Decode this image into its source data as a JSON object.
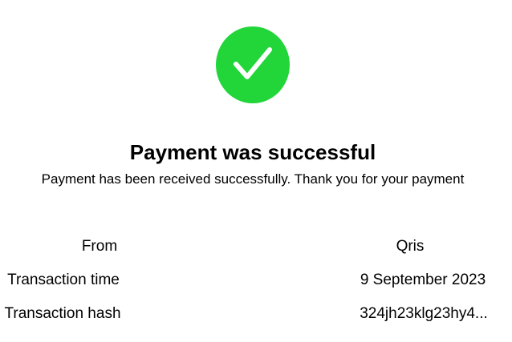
{
  "status": {
    "icon": "checkmark-icon",
    "icon_color": "#22d63a",
    "title": "Payment was successful",
    "message": "Payment has been received successfully. Thank you for your payment"
  },
  "details": [
    {
      "label": "From",
      "value": "Qris"
    },
    {
      "label": "Transaction time",
      "value": "9 September 2023"
    },
    {
      "label": "Transaction hash",
      "value": "324jh23klg23hy4..."
    }
  ]
}
